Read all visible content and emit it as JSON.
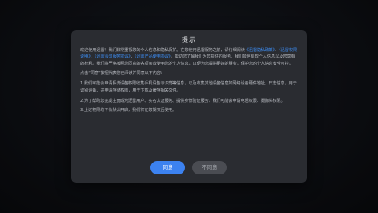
{
  "dialog": {
    "title": "提示",
    "intro_segments": [
      {
        "text": "欢迎使用迅雷！我们非常重视您的个人信息和隐私保护。在您使用迅雷服务之前，请仔细阅读",
        "link": false
      },
      {
        "text": "《迅雷隐私政策》",
        "link": true
      },
      {
        "text": "、",
        "link": false
      },
      {
        "text": "《迅雷权限说明》",
        "link": true
      },
      {
        "text": "、",
        "link": false
      },
      {
        "text": "《迅雷会员服务协议》",
        "link": true
      },
      {
        "text": "、",
        "link": false
      },
      {
        "text": "《迅雷产品使用协议》",
        "link": true
      },
      {
        "text": "，帮助您了解我们为您提供的服务、我们如何处理个人信息以及您享有的权利。我们将严格按照您同意的各项条款使用您的个人信息，以便为您提供更好的服务，保护您的个人信息安全可控。",
        "link": false
      }
    ],
    "paragraph_2": "点击“同意”按钮代表您已阅读并同意以下内容：",
    "paragraph_3": "1.我们可能会申请系统设备权限收集手机设备标识符等信息，以及收集其他设备信息如网络设备硬件地址、日志信息，用于识别设备、并申请存储权限，用于下载及缓存相关文件。",
    "paragraph_4": "2.为了帮助您完成注册成为迅雷用户、实名认证服务、提供身份验证服务，我们可能会申请电话权限、摄像头权限。",
    "paragraph_5": "3.上述权限均不会默认开启，我们将在您授权后使用。",
    "agree_label": "同意",
    "disagree_label": "不同意"
  },
  "colors": {
    "link": "#3d8ef5",
    "agree_button": "#3c82f0",
    "disagree_button": "#4a4c52",
    "dialog_background": "#2a2c31"
  }
}
